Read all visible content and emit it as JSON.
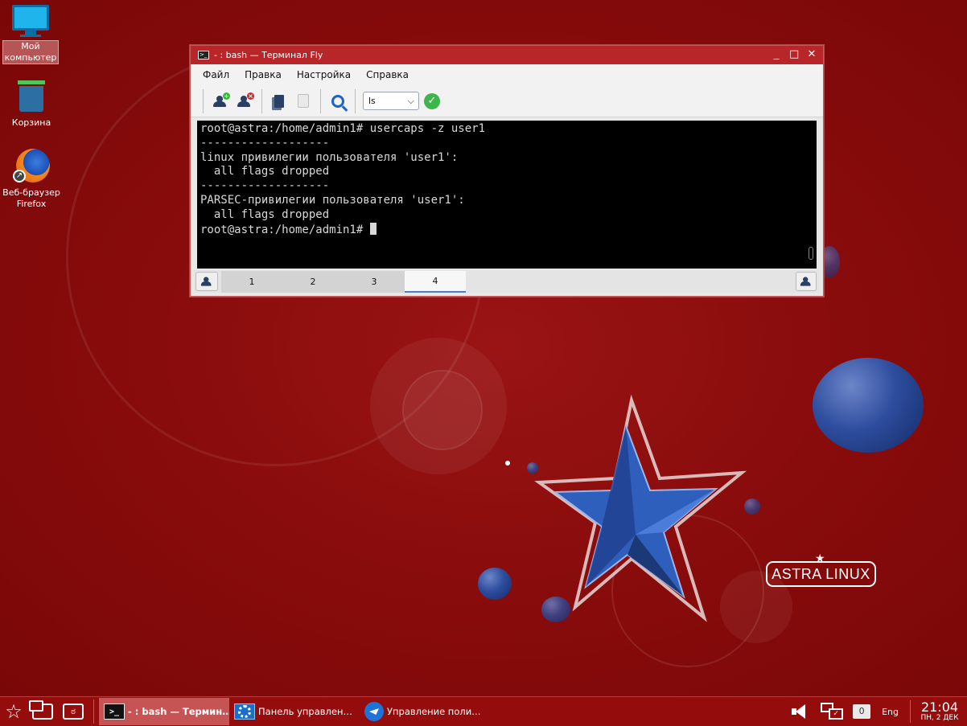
{
  "desktop": {
    "icons": [
      {
        "label_line1": "Мой",
        "label_line2": "компьютер"
      },
      {
        "label_line1": "Корзина",
        "label_line2": ""
      },
      {
        "label_line1": "Веб-браузер",
        "label_line2": "Firefox"
      }
    ],
    "logo_text": "ASTRA LINUX"
  },
  "window": {
    "title": "- : bash — Терминал Fly",
    "controls": {
      "minimize": "_",
      "maximize": "□",
      "close": "✕"
    },
    "menu": [
      "Файл",
      "Правка",
      "Настройка",
      "Справка"
    ],
    "toolbar": {
      "command_select_value": "ls",
      "buttons": [
        "add-user",
        "remove-user",
        "copy",
        "paste",
        "search",
        "run"
      ]
    },
    "terminal_lines": [
      "root@astra:/home/admin1# usercaps -z user1",
      "-------------------",
      "linux привилегии пользователя 'user1':",
      "  all flags dropped",
      "-------------------",
      "PARSEC-привилегии пользователя 'user1':",
      "  all flags dropped",
      "root@astra:/home/admin1# "
    ],
    "tabs": [
      "1",
      "2",
      "3",
      "4"
    ],
    "active_tab": "4"
  },
  "taskbar": {
    "tasks": [
      {
        "label": "- : bash — Термин…",
        "active": true
      },
      {
        "label": "Панель управлен…",
        "active": false
      },
      {
        "label": "Управление поли…",
        "active": false
      }
    ],
    "keyboard_badge": "0",
    "language": "Eng",
    "time": "21:04",
    "date": "ПН, 2 ДЕК"
  },
  "colors": {
    "desktop_bg": "#8f0d0d",
    "titlebar": "#b9262a",
    "taskbar": "#950c0c",
    "active_task": "#c75454",
    "terminal_bg": "#000000",
    "terminal_fg": "#d8d8d8"
  }
}
